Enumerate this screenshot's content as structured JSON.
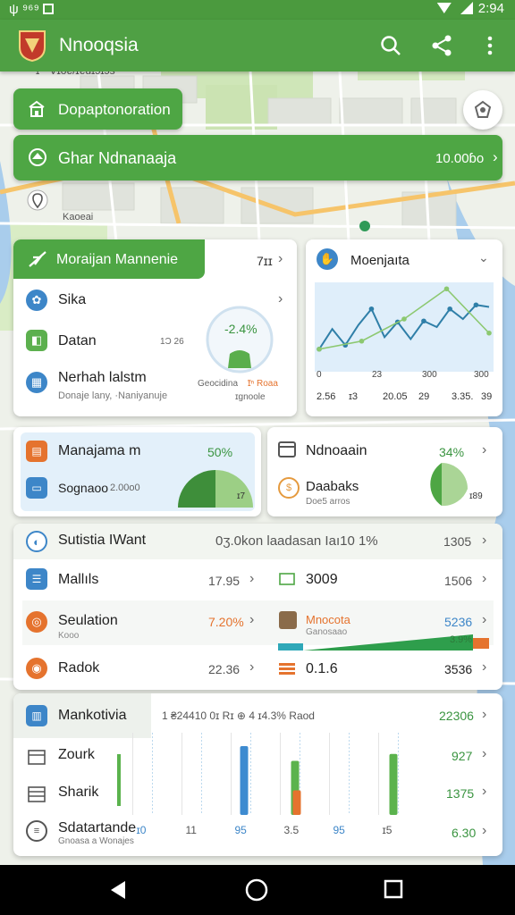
{
  "status_bar": {
    "left": "ψ ⁹⁶⁹",
    "time": "2:94"
  },
  "app_bar": {
    "title": "Nnooqsia"
  },
  "map": {
    "label_top": "ɪ̃ ᵔ Vɪoɐ/ɪɐuɪɔɪɔs",
    "label_left": "Kaoeai"
  },
  "department": {
    "label": "Dopaptonoration"
  },
  "search": {
    "label": "Ghar Ndnanaaja",
    "value": "10.00ɓo"
  },
  "manager_card": {
    "title": "Moraijan Mannenie",
    "title_value": "7ɪɪ",
    "rows": [
      {
        "label": "Sika",
        "sub": ""
      },
      {
        "label": "Datan",
        "sub": ""
      },
      {
        "label": "Nerhah lalstm",
        "sub": "Donaje lany, ·Naniyanuje"
      }
    ],
    "gauge_value": "-2.4%",
    "gauge_left": "1Ɔ 26",
    "gauge_caption_1": "Geocidina",
    "gauge_caption_2": "ɪ̃ⁿ Roaa",
    "gauge_caption_3": "ɪgnoole"
  },
  "line_card": {
    "title": "Moenjaıta",
    "y_ticks": [
      "0",
      "23",
      "300",
      "300"
    ],
    "x_ticks": [
      "2.56",
      "ɪ3",
      "20.05",
      "29",
      "3.35.",
      "39"
    ],
    "series_line": [
      18,
      38,
      22,
      42,
      58,
      30,
      45,
      28,
      46,
      40,
      58,
      48,
      62,
      60
    ],
    "series_green": [
      18,
      26,
      48,
      78,
      34
    ]
  },
  "management_card": {
    "title": "Manajama m",
    "percent": "50%",
    "sub_label": "Sognaoo",
    "sub_value": "2.00o0",
    "pie_label": "ɪ7"
  },
  "ndnoaain_card": {
    "title": "Ndnoaain",
    "percent": "34%",
    "sub_label": "Daabaks",
    "sub_caption": "Doe5 arros",
    "pie_label": "ɪ89"
  },
  "stats_list": {
    "header": {
      "label": "Sutistia IWant",
      "detail": "0ʒ.0kon laadasan Iaı10 1%",
      "value": "1305"
    },
    "rows": [
      {
        "label": "Mallıls",
        "value": "17.95",
        "mid_label": "3009",
        "right_value": "1506"
      },
      {
        "label": "Seulation",
        "value": "7.20%",
        "sub": "Kooo",
        "mid_label": "Mnocota",
        "mid_sub": "Ganosaao",
        "right_value": "5236",
        "bar_value": "3.9%"
      },
      {
        "label": "Radok",
        "value": "22.36",
        "mid_label": "0.1.6",
        "right_value": "3536"
      }
    ]
  },
  "bottom_card": {
    "rows": [
      {
        "label": "Mankotivia",
        "value": "22306"
      },
      {
        "label": "Zourk",
        "value": "927"
      },
      {
        "label": "Sharik",
        "value": "1375"
      },
      {
        "label": "Sdatartande",
        "sub": "Gnoasa a Wonajes",
        "value": "6.30"
      }
    ],
    "chart_header": "1  ₴24410 0ɪ Rɪ  ⊕ 4 ɪ4.3% Raod",
    "x_ticks": [
      "ɪ0",
      "11",
      "95",
      "3.5",
      "95",
      "ɪ5"
    ]
  },
  "chart_data": [
    {
      "type": "line",
      "title": "Moenjaıta",
      "x": [
        "2.56",
        "ɪ3",
        "20.05",
        "29",
        "3.35.",
        "39"
      ],
      "series": [
        {
          "color": "#2f7fa8",
          "values": [
            18,
            38,
            22,
            42,
            58,
            30,
            45,
            28,
            46,
            40,
            58,
            48,
            62,
            60
          ]
        },
        {
          "color": "#8cc870",
          "values": [
            18,
            26,
            48,
            78,
            34
          ]
        }
      ]
    },
    {
      "type": "bar",
      "categories": [
        "ɪ0",
        "11",
        "95",
        "3.5",
        "95",
        "ɪ5"
      ],
      "series": [
        {
          "color": "#3e8bd0",
          "values": [
            0,
            0,
            70,
            0,
            0,
            0
          ]
        },
        {
          "color": "#5bb34d",
          "values": [
            0,
            0,
            0,
            55,
            0,
            62
          ]
        },
        {
          "color": "#e5732e",
          "values": [
            0,
            0,
            0,
            25,
            0,
            0
          ]
        }
      ]
    }
  ],
  "colors": {
    "primary": "#4fa044",
    "accent": "#2f7fa8",
    "orange": "#e5732e"
  }
}
